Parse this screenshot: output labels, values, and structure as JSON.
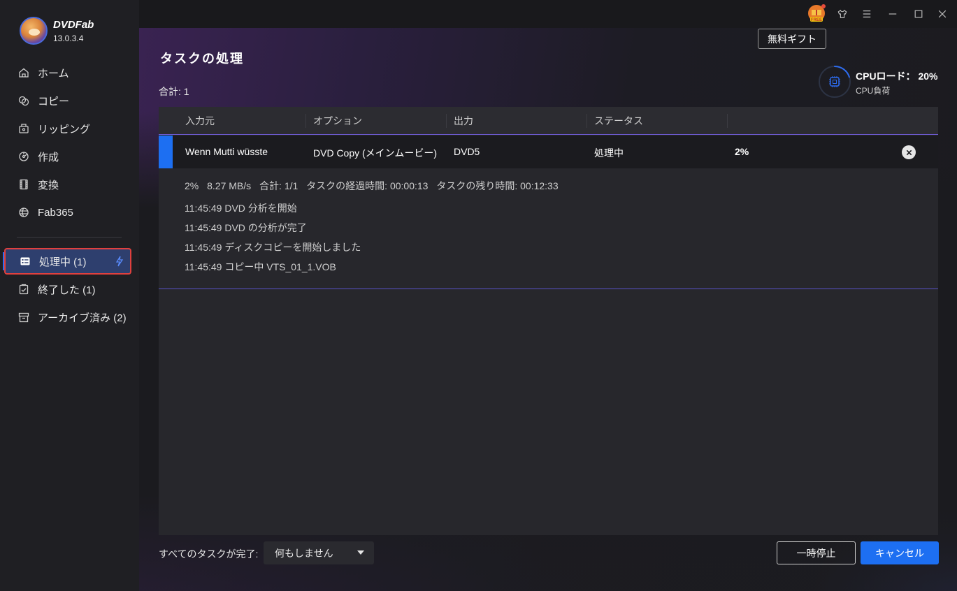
{
  "app": {
    "name": "DVDFab",
    "version": "13.0.3.4"
  },
  "sidebar": {
    "items": [
      {
        "label": "ホーム",
        "icon": "home-icon"
      },
      {
        "label": "コピー",
        "icon": "copy-icon"
      },
      {
        "label": "リッピング",
        "icon": "ripper-icon"
      },
      {
        "label": "作成",
        "icon": "creator-icon"
      },
      {
        "label": "変換",
        "icon": "film-icon"
      },
      {
        "label": "Fab365",
        "icon": "fab365-icon"
      }
    ],
    "queue": [
      {
        "label": "処理中 (1)",
        "icon": "task-list-icon",
        "active": true
      },
      {
        "label": "終了した (1)",
        "icon": "finished-icon"
      },
      {
        "label": "アーカイブ済み (2)",
        "icon": "archive-icon"
      }
    ]
  },
  "header": {
    "gift_tooltip": "無料ギフト",
    "gift_badge": "FREE",
    "title": "タスクの処理",
    "total": "合計: 1",
    "cpu_title": "CPUロード： 20%",
    "cpu_sub": "CPU負荷",
    "cpu_load": 20
  },
  "table": {
    "columns": [
      "入力元",
      "オプション",
      "出力",
      "ステータス"
    ],
    "row": {
      "source": "Wenn Mutti wüsste",
      "option": "DVD Copy (メインムービー)",
      "output": "DVD5",
      "status": "処理中",
      "progress": "2%"
    },
    "detail": {
      "stats": [
        "2%",
        "8.27 MB/s",
        "合計: 1/1",
        "タスクの経過時間: 00:00:13",
        "タスクの残り時間: 00:12:33"
      ],
      "log": [
        "11:45:49  DVD 分析を開始",
        "11:45:49  DVD の分析が完了",
        "11:45:49  ディスクコピーを開始しました",
        "11:45:49  コピー中 VTS_01_1.VOB"
      ]
    }
  },
  "footer": {
    "label": "すべてのタスクが完了:",
    "select_value": "何もしません",
    "pause": "一時停止",
    "cancel": "キャンセル"
  },
  "colors": {
    "accent": "#1d6ff2",
    "highlight_border": "#e0403e"
  }
}
